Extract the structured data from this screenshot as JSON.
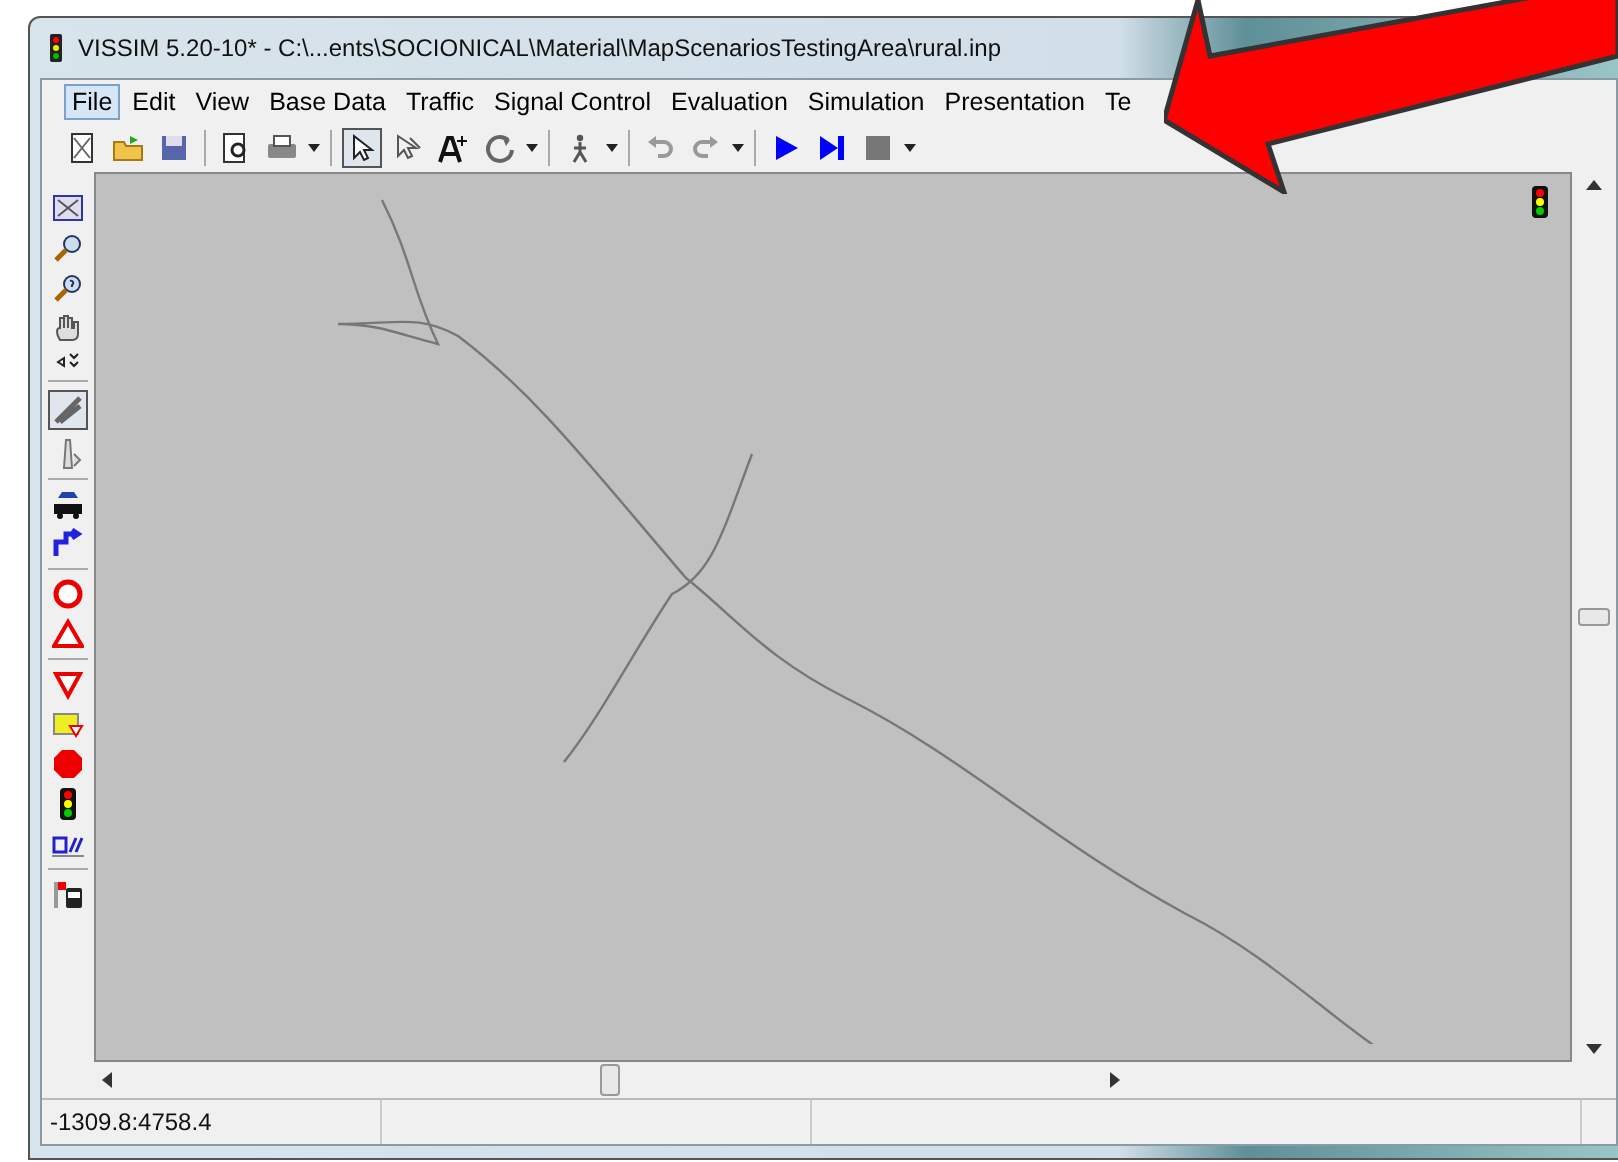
{
  "window": {
    "title": "VISSIM 5.20-10* - C:\\...ents\\SOCIONICAL\\Material\\MapScenariosTestingArea\\rural.inp"
  },
  "menu": [
    {
      "label": "File",
      "selected": true
    },
    {
      "label": "Edit",
      "selected": false
    },
    {
      "label": "View",
      "selected": false
    },
    {
      "label": "Base Data",
      "selected": false
    },
    {
      "label": "Traffic",
      "selected": false
    },
    {
      "label": "Signal Control",
      "selected": false
    },
    {
      "label": "Evaluation",
      "selected": false
    },
    {
      "label": "Simulation",
      "selected": false
    },
    {
      "label": "Presentation",
      "selected": false
    },
    {
      "label": "Te",
      "selected": false
    }
  ],
  "status_bar": {
    "coordinates": "-1309.8:4758.4"
  }
}
